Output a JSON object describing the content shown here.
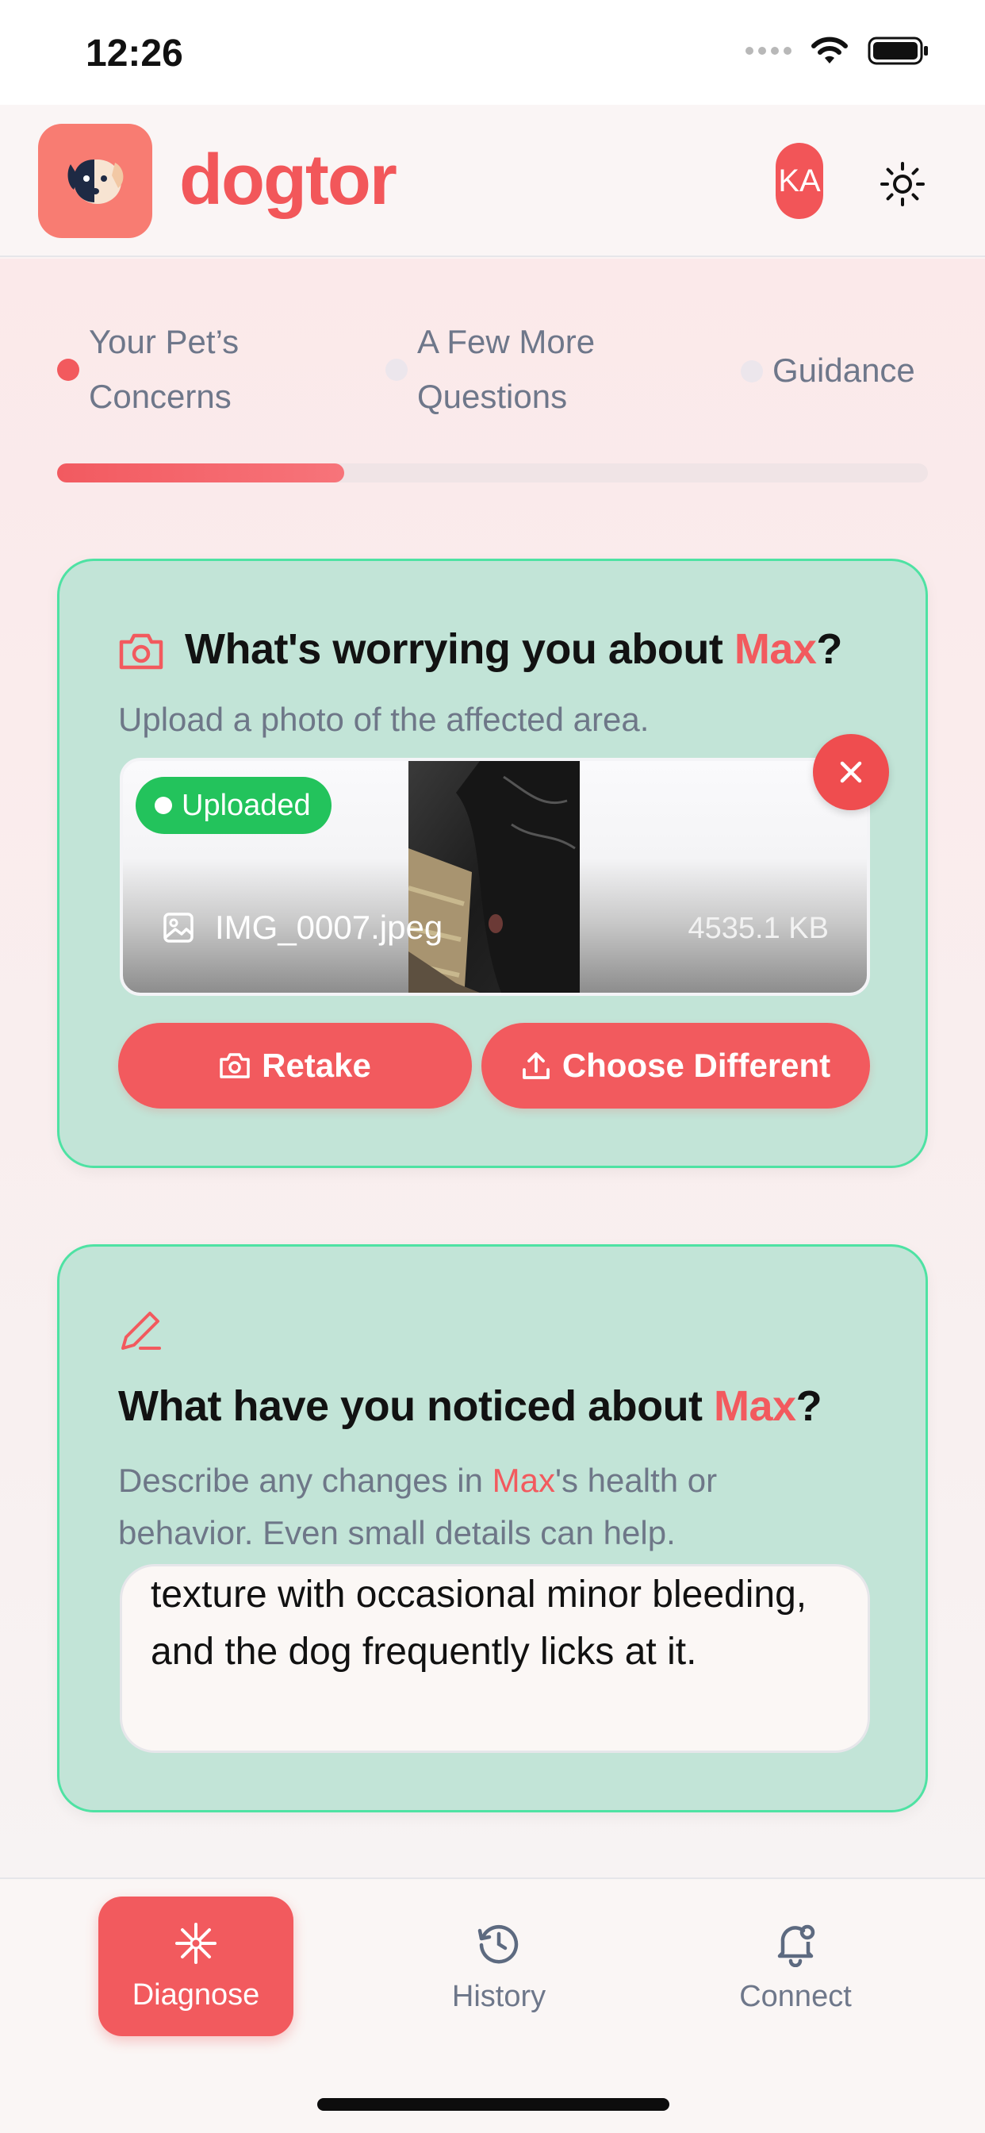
{
  "status_bar": {
    "time": "12:26"
  },
  "header": {
    "brand": "dogtor",
    "avatar_initials": "KA"
  },
  "stepper": {
    "steps": [
      {
        "line1": "Your Pet’s",
        "line2": "Concerns",
        "active": true
      },
      {
        "line1": "A Few More",
        "line2": "Questions",
        "active": false
      },
      {
        "label": "Guidance",
        "active": false
      }
    ],
    "progress": 0.33
  },
  "photo_card": {
    "title_prefix": "What's worrying you about ",
    "pet_name": "Max",
    "title_suffix": "?",
    "subtitle": "Upload a photo of the affected area.",
    "badge": "Uploaded",
    "file_name": "IMG_0007.jpeg",
    "file_size": "4535.1 KB",
    "retake_label": "Retake",
    "choose_label": "Choose Different"
  },
  "notes_card": {
    "title_prefix": "What have you noticed about ",
    "pet_name": "Max",
    "title_suffix": "?",
    "sub_prefix": "Describe any changes in ",
    "sub_suffix": "'s health or behavior. Even small details can help.",
    "text": "texture with occasional minor bleeding, and the dog frequently licks at it."
  },
  "nav": {
    "items": [
      {
        "label": "Diagnose",
        "icon": "asterisk-icon"
      },
      {
        "label": "History",
        "icon": "clock-icon"
      },
      {
        "label": "Connect",
        "icon": "bell-icon"
      }
    ]
  },
  "colors": {
    "accent": "#f25a5e",
    "card_bg": "#c2e4d7",
    "card_border": "#4ee2a3",
    "success": "#23c35c"
  }
}
